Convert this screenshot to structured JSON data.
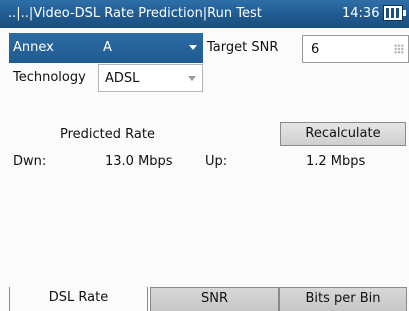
{
  "titlebar": {
    "title": "..|..|Video-DSL Rate Prediction|Run Test",
    "time": "14:36"
  },
  "form": {
    "annex_label": "Annex",
    "annex_value": "A",
    "target_snr_label": "Target SNR",
    "target_snr_value": "6",
    "technology_label": "Technology",
    "technology_value": "ADSL"
  },
  "rates": {
    "heading": "Predicted Rate",
    "recalculate_label": "Recalculate",
    "down_label": "Dwn:",
    "down_value": "13.0 Mbps",
    "up_label": "Up:",
    "up_value": "1.2 Mbps"
  },
  "tabs": [
    {
      "label": "DSL Rate",
      "active": true
    },
    {
      "label": "SNR",
      "active": false
    },
    {
      "label": "Bits per Bin",
      "active": false
    }
  ],
  "colors": {
    "titlebar": "#1f5a8f",
    "selected_field": "#2563a0"
  },
  "icons": {
    "battery": "battery-icon",
    "dropdown": "chevron-down-icon",
    "keypad": "keypad-icon"
  }
}
